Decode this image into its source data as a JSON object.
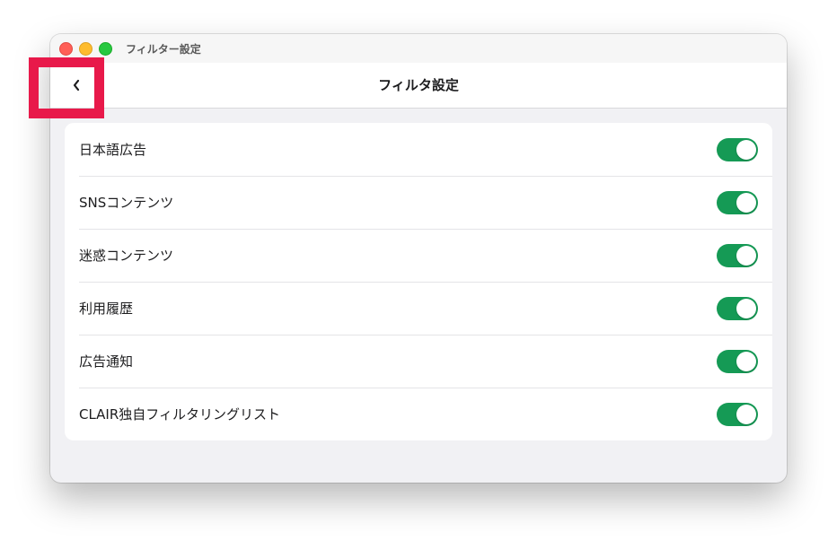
{
  "window": {
    "title": "フィルター設定"
  },
  "navbar": {
    "back_symbol": "‹",
    "title": "フィルタ設定"
  },
  "colors": {
    "toggle_on": "#159a55",
    "highlight": "#e8194a"
  },
  "settings": [
    {
      "label": "日本語広告",
      "enabled": true
    },
    {
      "label": "SNSコンテンツ",
      "enabled": true
    },
    {
      "label": "迷惑コンテンツ",
      "enabled": true
    },
    {
      "label": "利用履歴",
      "enabled": true
    },
    {
      "label": "広告通知",
      "enabled": true
    },
    {
      "label": "CLAIR独自フィルタリングリスト",
      "enabled": true
    }
  ]
}
